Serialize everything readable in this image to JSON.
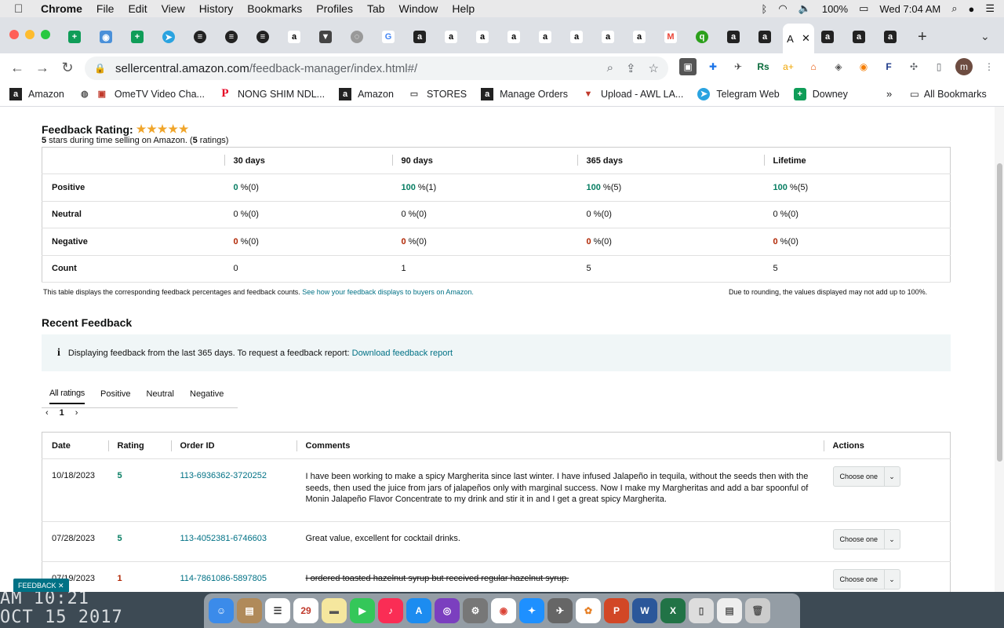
{
  "menubar": {
    "app": "Chrome",
    "items": [
      "File",
      "Edit",
      "View",
      "History",
      "Bookmarks",
      "Profiles",
      "Tab",
      "Window",
      "Help"
    ],
    "battery": "100%",
    "clock": "Wed 7:04 AM"
  },
  "browser": {
    "url_host": "sellercentral.amazon.com",
    "url_path": "/feedback-manager/index.html#/",
    "active_tab_label": "A",
    "profile_initial": "m"
  },
  "bookmarks": {
    "items": [
      "Amazon",
      "OmeTV Video Cha...",
      "NONG SHIM NDL...",
      "Amazon",
      "STORES",
      "Manage Orders",
      "Upload - AWL LA...",
      "Telegram Web",
      "Downey"
    ],
    "more": "»",
    "all": "All Bookmarks"
  },
  "feedback_rating": {
    "title": "Feedback Rating:",
    "stars": "★★★★★",
    "stars_count": "5",
    "subtitle_mid": " stars during time selling on Amazon. (",
    "ratings_count": "5",
    "subtitle_end": " ratings)"
  },
  "rating_table": {
    "headers": [
      "30 days",
      "90 days",
      "365 days",
      "Lifetime"
    ],
    "rows": [
      {
        "label": "Positive",
        "cells": [
          {
            "v": "0",
            "s": " %(0)"
          },
          {
            "v": "100",
            "s": " %(1)"
          },
          {
            "v": "100",
            "s": " %(5)"
          },
          {
            "v": "100",
            "s": " %(5)"
          }
        ]
      },
      {
        "label": "Neutral",
        "cells": [
          {
            "v": "0",
            "s": " %(0)"
          },
          {
            "v": "0",
            "s": " %(0)"
          },
          {
            "v": "0",
            "s": " %(0)"
          },
          {
            "v": "0",
            "s": " %(0)"
          }
        ]
      },
      {
        "label": "Negative",
        "cells": [
          {
            "v": "0",
            "s": " %(0)"
          },
          {
            "v": "0",
            "s": " %(0)"
          },
          {
            "v": "0",
            "s": " %(0)"
          },
          {
            "v": "0",
            "s": " %(0)"
          }
        ]
      },
      {
        "label": "Count",
        "cells": [
          {
            "v": "0"
          },
          {
            "v": "1"
          },
          {
            "v": "5"
          },
          {
            "v": "5"
          }
        ]
      }
    ],
    "note_left": "This table displays the corresponding feedback percentages and feedback counts. ",
    "note_link": "See how your feedback displays to buyers on Amazon.",
    "note_right": "Due to rounding, the values displayed may not add up to 100%."
  },
  "recent_feedback": {
    "title": "Recent Feedback",
    "info_icon": "i",
    "info_text": "Displaying feedback from the last 365 days. To request a feedback report: ",
    "info_link": "Download feedback report",
    "tabs": [
      "All ratings",
      "Positive",
      "Neutral",
      "Negative"
    ],
    "pager_prev": "‹",
    "pager_page": "1",
    "pager_next": "›",
    "columns": [
      "Date",
      "Rating",
      "Order ID",
      "Comments",
      "Actions"
    ],
    "rows": [
      {
        "date": "10/18/2023",
        "rating": "5",
        "order_id": "113-6936362-3720252",
        "comment": "I have been working to make a spicy Margherita since last winter. I have infused Jalapeño in tequila, without the seeds then with the seeds, then used the juice from jars of jalapeños only with marginal success. Now I make my Margheritas and add a bar spoonful of Monin Jalapeño Flavor Concentrate to my drink and stir it in and I get a great spicy Margherita.",
        "action": "Choose one"
      },
      {
        "date": "07/28/2023",
        "rating": "5",
        "order_id": "113-4052381-6746603",
        "comment": "Great value, excellent for cocktail drinks.",
        "action": "Choose one"
      },
      {
        "date": "07/19/2023",
        "rating": "1",
        "order_id": "114-7861086-5897805",
        "comment": "I ordered toasted hazelnut syrup but received regular hazelnut syrup.",
        "action": "Choose one"
      }
    ]
  },
  "feedback_tag": "FEEDBACK ✕",
  "desktop_text": [
    "AM 10:21",
    "OCT 15 2017"
  ],
  "colors": {
    "positive": "#067d62",
    "negative": "#b12704",
    "link": "#007185"
  }
}
